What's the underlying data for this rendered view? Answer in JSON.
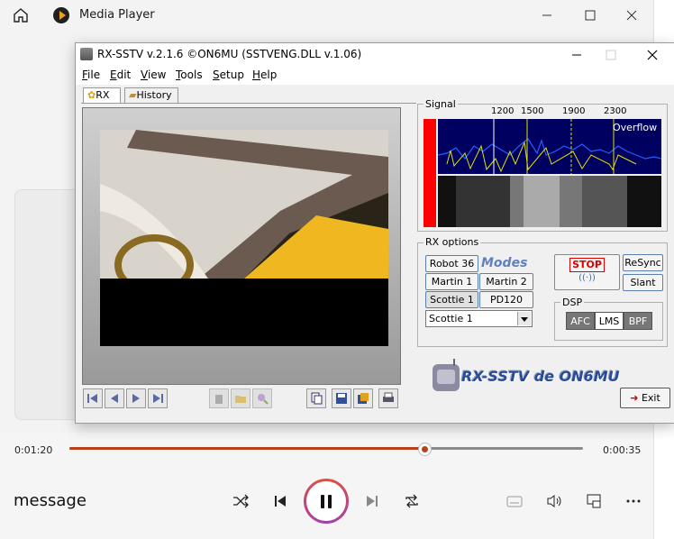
{
  "media_player": {
    "title": "Media Player",
    "elapsed": "0:01:20",
    "total": "0:00:35",
    "progress": 0.69,
    "track_title": "message",
    "accent": "#b8401a"
  },
  "rx": {
    "title": "RX-SSTV v.2.1.6 ©ON6MU (SSTVENG.DLL v.1.06)",
    "menu": [
      "File",
      "Edit",
      "View",
      "Tools",
      "Setup",
      "Help"
    ],
    "tabs": [
      "RX",
      "History"
    ],
    "signal": {
      "label": "Signal",
      "freqs": [
        "1200",
        "1500",
        "1900",
        "2300"
      ],
      "overflow": "Overflow"
    },
    "rx_options": {
      "label": "RX options",
      "modes_label": "Modes",
      "modes": [
        "Robot 36",
        "Martin 1",
        "Martin 2",
        "Scottie 1",
        "PD120"
      ],
      "selected_mode": "Scottie 1",
      "stop": "STOP",
      "resync": "ReSync",
      "slant": "Slant"
    },
    "dsp": {
      "label": "DSP",
      "buttons": [
        "AFC",
        "LMS",
        "BPF"
      ]
    },
    "logo": "RX-SSTV de ON6MU",
    "exit": "Exit"
  }
}
